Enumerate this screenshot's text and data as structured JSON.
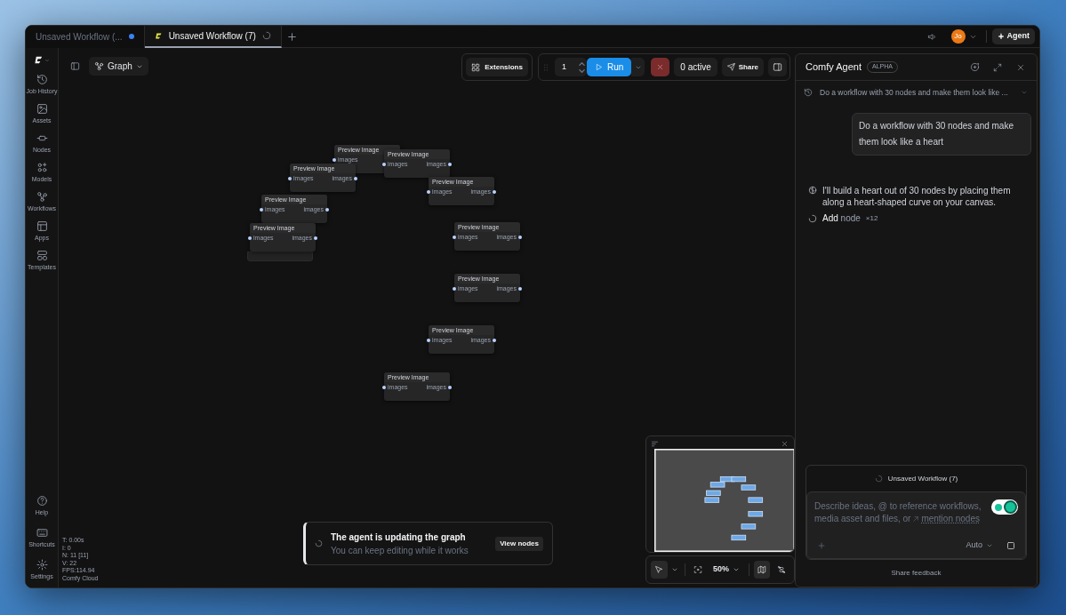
{
  "tabs": [
    {
      "label": "Unsaved Workflow (...",
      "selected": false,
      "kind": "unsaved"
    },
    {
      "label": "Unsaved Workflow (7)",
      "selected": true,
      "kind": "running"
    }
  ],
  "account": {
    "avatar": "Jo"
  },
  "agent_button": "Agent",
  "sidebar": {
    "items": [
      {
        "label": "Job History"
      },
      {
        "label": "Assets"
      },
      {
        "label": "Nodes"
      },
      {
        "label": "Models"
      },
      {
        "label": "Workflows"
      },
      {
        "label": "Apps"
      },
      {
        "label": "Templates"
      }
    ],
    "bottom_items": [
      {
        "label": "Help"
      },
      {
        "label": "Shortcuts"
      },
      {
        "label": "Settings"
      }
    ]
  },
  "view_menu": "Graph",
  "toolbar": {
    "extensions": "Extensions",
    "batch_count": "1",
    "run": "Run",
    "queue_status": "0 active",
    "share": "Share"
  },
  "stats": [
    "T: 0.00s",
    "I: 0",
    "N: 11 [11]",
    "V: 22",
    "FPS:114.94",
    "Comfy Cloud"
  ],
  "nodes": [
    {
      "title": "Preview Image",
      "input": "images"
    },
    {
      "title": "Preview Image",
      "input": "images",
      "output": "images"
    },
    {
      "title": "Preview Image",
      "input": "images",
      "output": "images"
    },
    {
      "title": "Preview Image",
      "input": "images",
      "output": "images"
    },
    {
      "title": "Preview Image",
      "input": "images",
      "output": "images"
    },
    {
      "title": "Preview Image",
      "input": "images",
      "output": "images"
    },
    {
      "title": "Preview Image",
      "input": "images",
      "output": "images"
    },
    {
      "title": "Preview Image",
      "input": "images",
      "output": "images"
    },
    {
      "title": "Preview Image",
      "input": "images",
      "output": "images"
    },
    {
      "title": "Preview Image",
      "input": "images",
      "output": "images"
    }
  ],
  "toast": {
    "title": "The agent is updating the graph",
    "subtitle": "You can keep editing while it works",
    "action": "View nodes"
  },
  "canvas_controls": {
    "zoom": "50%",
    "minimap_on": true
  },
  "agent_panel": {
    "title": "Comfy Agent",
    "badge": "ALPHA",
    "conversation": "Do a workflow with 30 nodes and make them look like ...",
    "messages": [
      {
        "kind": "user",
        "text": "Do a workflow with 30 nodes and make them look like a heart"
      },
      {
        "kind": "agent",
        "text": "I'll build a heart out of 30 nodes by placing them along a heart-shaped curve on your canvas."
      }
    ],
    "steps": [
      {
        "text": "**Add** node",
        "count": "×12",
        "running": true
      }
    ],
    "composer": {
      "context": "Unsaved Workflow (7)",
      "placeholder_lines": [
        "Describe ideas, @ to reference workflows,",
        "media asset and files, or"
      ],
      "mention": "mention nodes",
      "mode": "Auto"
    },
    "feedback": "Share feedback"
  }
}
